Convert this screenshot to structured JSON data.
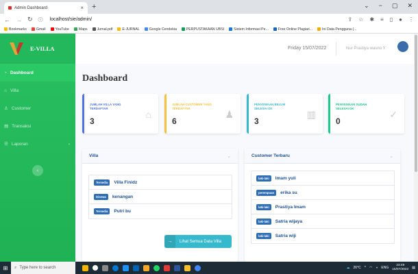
{
  "browser": {
    "tab_title": "Admin Dashboard",
    "new_tab": "+",
    "url": "localhost/sie/admin/",
    "window_controls": [
      "⌄",
      "−",
      "▢",
      "✕"
    ],
    "bookmarks": [
      "Bookmarks",
      "Gmail",
      "YouTube",
      "Maps",
      "Jurnal.pdf",
      "E-JURNAL",
      "Google Cendekia",
      "PERPUSTAKAAN UBSI",
      "Sistem Informasi Pe...",
      "Free Online Plagiari...",
      "Ini Data Pengguna (..."
    ]
  },
  "sidebar": {
    "brand": "E-VILLA",
    "items": [
      {
        "label": "Dashboard",
        "icon": "tachometer-icon",
        "glyph": "◔"
      },
      {
        "label": "Villa",
        "icon": "home-icon",
        "glyph": "⌂"
      },
      {
        "label": "Customer",
        "icon": "user-icon",
        "glyph": "♙"
      },
      {
        "label": "Transaksi",
        "icon": "table-icon",
        "glyph": "▤"
      },
      {
        "label": "Laporan",
        "icon": "list-icon",
        "glyph": "☰"
      }
    ],
    "collapse_glyph": "‹"
  },
  "topbar": {
    "date": "Friday  15/07/2022",
    "username": "Nur Prastiya wasno Y"
  },
  "main": {
    "title": "Dashboard",
    "stats": [
      {
        "label": "JUMLAH VILLA YANG TERDAFTAR",
        "value": "3",
        "color": "#4e73df",
        "icon": "home-icon",
        "glyph": "⌂"
      },
      {
        "label": "JUMLAH CUSTOMER YANG TERDAFTAR",
        "value": "6",
        "color": "#f6c23e",
        "icon": "user-icon",
        "glyph": "♟"
      },
      {
        "label": "PENYEWAAN BELUM SELESAI OK",
        "value": "3",
        "color": "#36b9cc",
        "icon": "clipboard-icon",
        "glyph": "▥"
      },
      {
        "label": "PENYEWAAN SUDAH SELESAI OK",
        "value": "0",
        "color": "#1cc88a",
        "icon": "check-icon",
        "glyph": "✓"
      }
    ],
    "villa_panel": {
      "title": "Villa",
      "items": [
        {
          "badge": "Tersedia",
          "name": "Villa Finidz"
        },
        {
          "badge": "Disewa",
          "name": "kenangan"
        },
        {
          "badge": "Tersedia",
          "name": "Putri bu"
        }
      ],
      "see_all": "Lihat Semua Data Villa"
    },
    "customer_panel": {
      "title": "Customer Terbaru",
      "items": [
        {
          "badge": "laki-laki",
          "name": "Imam yuli"
        },
        {
          "badge": "perempuan",
          "name": "erika su"
        },
        {
          "badge": "laki-laki",
          "name": "Prastiya Imam"
        },
        {
          "badge": "laki-laki",
          "name": "Satria wijaya"
        },
        {
          "badge": "laki-laki",
          "name": "Satria wiji"
        }
      ]
    }
  },
  "taskbar": {
    "search_placeholder": "Type here to search",
    "weather": "26°C",
    "lang": "ENG",
    "time": "23:49",
    "date": "15/07/2022"
  }
}
